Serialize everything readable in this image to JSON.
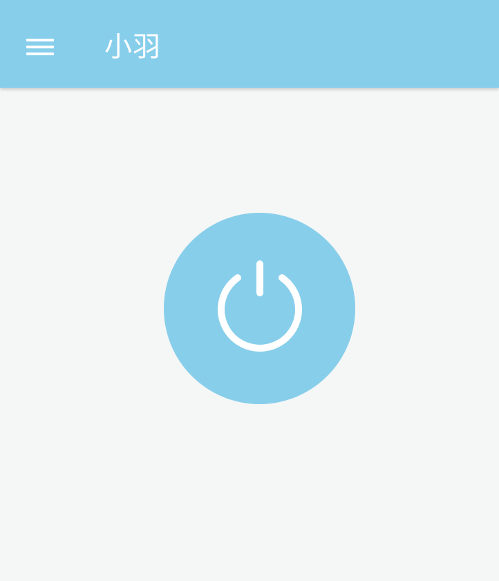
{
  "app_bar": {
    "title": "小羽",
    "menu_icon": "hamburger-menu-icon",
    "background_color": "#87ceeb",
    "text_color": "#ffffff"
  },
  "main": {
    "power_button": {
      "icon": "power-icon",
      "background_color": "#87ceeb",
      "icon_color": "#ffffff"
    },
    "background_color": "#f4f7f6"
  }
}
